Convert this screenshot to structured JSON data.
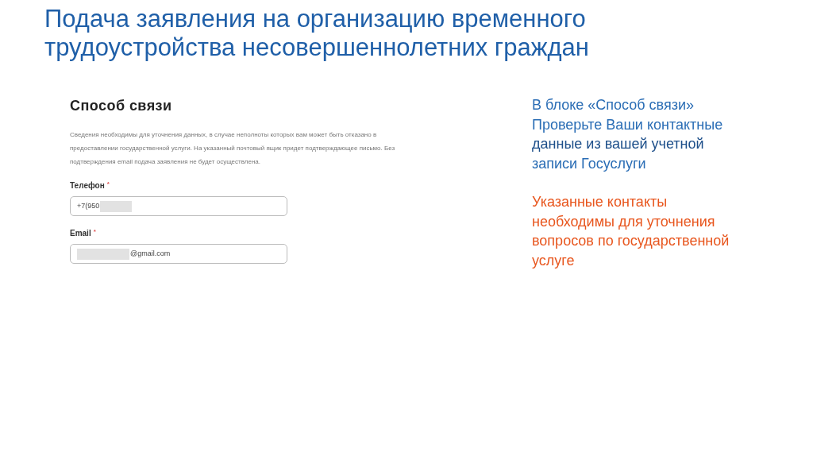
{
  "title": "Подача заявления на организацию временного трудоустройства несовершеннолетних граждан",
  "form": {
    "heading": "Способ связи",
    "description": "Сведения необходимы для уточнения данных, в случае неполноты которых вам может быть отказано в предоставлении государственной услуги. На указанный почтовый ящик придет подтверждающее письмо. Без подтверждения email подача заявления не будет осуществлена.",
    "fields": [
      {
        "label": "Телефон",
        "required_mark": "*",
        "value": "+7(950",
        "blurred_after": true
      },
      {
        "label": "Email",
        "required_mark": "*",
        "value": "@gmail.com",
        "blurred_before": true
      }
    ]
  },
  "notes": [
    {
      "kind": "info",
      "text": "В блоке «Способ связи» Проверьте Ваши контактные **данные из вашей учетной** записи Госуслуги"
    },
    {
      "kind": "warning",
      "text": "Указанные контакты необходимы для уточнения вопросов по государственной услуге"
    }
  ]
}
